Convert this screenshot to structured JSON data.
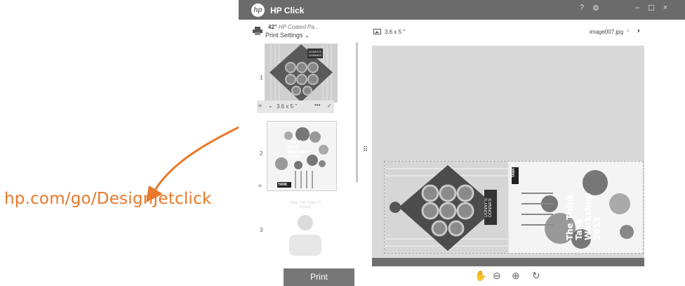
{
  "promo": {
    "url": "hp.com/go/DesignJetclick",
    "accent_color": "#e8782a"
  },
  "window": {
    "title": "HP Click",
    "logo_text": "hp",
    "controls": [
      {
        "name": "help-button",
        "label": "?"
      },
      {
        "name": "settings-button",
        "label": "⚙"
      },
      {
        "name": "minimize-button",
        "label": "–"
      },
      {
        "name": "maximize-button",
        "label": "☐"
      },
      {
        "name": "close-button",
        "label": "×"
      }
    ]
  },
  "printer": {
    "size": "42\"",
    "paper": "HP Coated Pa...",
    "settings_label": "Print Settings"
  },
  "thumbnails": [
    {
      "number": "1",
      "title": "DONNY'S DONNA'S",
      "size_label": "3.6 x 5 \""
    },
    {
      "number": "2",
      "title": "The Think Tank Workshop 2013",
      "badge": "TANK"
    },
    {
      "number": "3",
      "title": "TAKE THE TIME TO FINDS"
    }
  ],
  "print_button": "Print",
  "preview": {
    "size_label": "3.6 x 5 \"",
    "filename": "image007.jpg",
    "prev": "‹",
    "next": "›",
    "left_image_title": "DONNY'S DONNA'S",
    "right_image_title": "The Think Tank Workshop 2013",
    "right_badge": "TANK"
  },
  "tools": [
    {
      "name": "pan-tool-icon",
      "glyph": "✋"
    },
    {
      "name": "zoom-out-icon",
      "glyph": "⊖"
    },
    {
      "name": "zoom-in-icon",
      "glyph": "⊕"
    },
    {
      "name": "rotate-icon",
      "glyph": "↻"
    }
  ]
}
